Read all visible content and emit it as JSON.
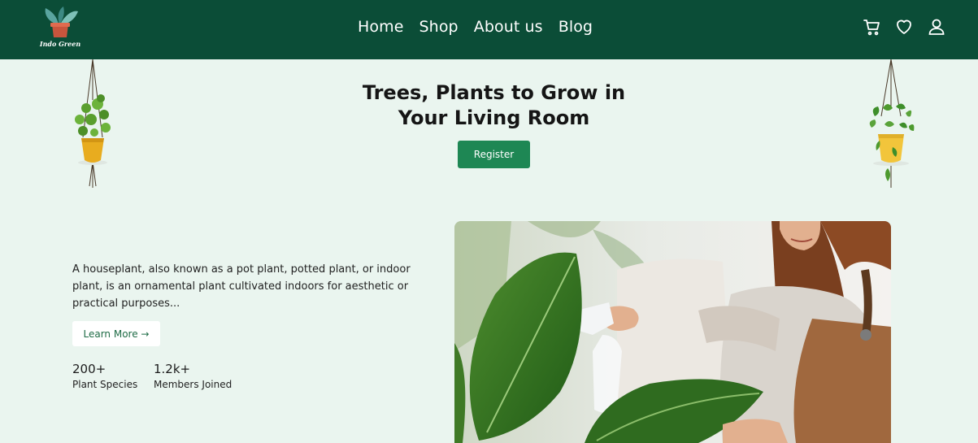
{
  "brand": {
    "name": "Indo Green"
  },
  "nav": {
    "links": [
      "Home",
      "Shop",
      "About us",
      "Blog"
    ],
    "icons": [
      "cart-icon",
      "heart-icon",
      "user-icon"
    ]
  },
  "hero": {
    "title_line1": "Trees, Plants to Grow in",
    "title_line2": "Your Living Room",
    "register_label": "Register"
  },
  "content": {
    "description": "A houseplant, also known as a pot plant, potted plant, or indoor plant, is an ornamental plant cultivated indoors for aesthetic or practical purposes...",
    "learn_more_label": "Learn More →",
    "stats": [
      {
        "value": "200+",
        "label": "Plant Species"
      },
      {
        "value": "1.2k+",
        "label": "Members Joined"
      }
    ]
  },
  "colors": {
    "nav_bg": "#0b4d37",
    "page_bg": "#eaf5ef",
    "accent": "#1e8754"
  }
}
